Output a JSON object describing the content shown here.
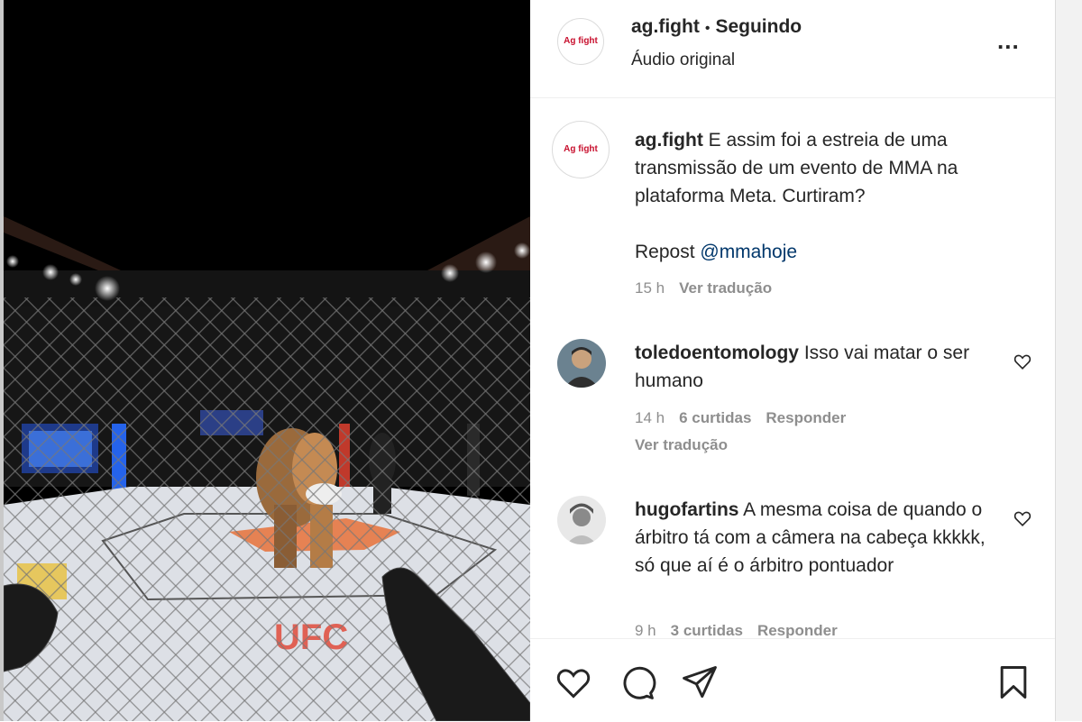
{
  "post": {
    "username": "ag.fight",
    "follow_status": "Seguindo",
    "audio": "Áudio original",
    "logo_text": "Ag fight",
    "more_label": "..."
  },
  "caption": {
    "username": "ag.fight",
    "text": " E assim foi a estreia de uma transmissão de um evento de MMA na plataforma Meta. Curtiram?",
    "repost_label": "Repost ",
    "repost_mention": "@mmahoje",
    "time": "15 h",
    "translate": "Ver tradução"
  },
  "comments": [
    {
      "username": "toledoentomology",
      "text": " Isso vai matar o ser humano",
      "time": "14 h",
      "likes": "6 curtidas",
      "reply": "Responder",
      "translate": "Ver tradução"
    },
    {
      "username": "hugofartins",
      "text": " A mesma coisa de quando o árbitro tá com a câmera na cabeça kkkkk, só que aí é o árbitro pontuador",
      "time": "9 h",
      "likes": "3 curtidas",
      "reply": "Responder"
    }
  ],
  "icons": {
    "like": "heart-icon",
    "comment": "comment-icon",
    "share": "share-icon",
    "save": "bookmark-icon",
    "more": "more-icon"
  },
  "colors": {
    "text": "#262626",
    "muted": "#8e8e8e",
    "mention": "#00376b",
    "brand": "#c8102e"
  }
}
